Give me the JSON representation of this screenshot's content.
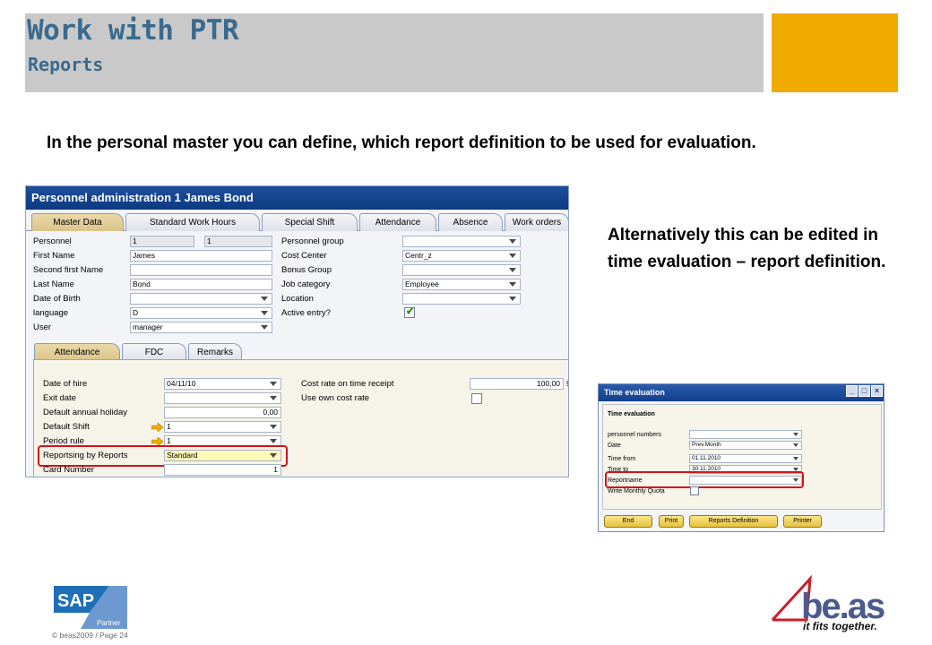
{
  "slide": {
    "title": "Work with PTR",
    "subtitle": "Reports",
    "intro_text": "In the personal master you can define, which report definition to be used for evaluation.",
    "alt_text": "Alternatively this can be edited in time evaluation – report definition.",
    "accent_color": "#f0ab00",
    "title_color": "#3a6a8e"
  },
  "personnel_window": {
    "title": "Personnel administration 1 James Bond",
    "tabs": [
      "Master Data",
      "Standard Work Hours",
      "Special Shift",
      "Attendance",
      "Absence",
      "Work orders"
    ],
    "active_tab": "Master Data",
    "left_fields": {
      "personnel_label": "Personnel",
      "personnel_value1": "1",
      "personnel_value2": "1",
      "first_name_label": "First Name",
      "first_name_value": "James",
      "second_first_name_label": "Second first Name",
      "second_first_name_value": "",
      "last_name_label": "Last Name",
      "last_name_value": "Bond",
      "date_of_birth_label": "Date of Birth",
      "date_of_birth_value": "",
      "language_label": "language",
      "language_value": "D",
      "user_label": "User",
      "user_value": "manager"
    },
    "right_fields": {
      "personnel_group_label": "Personnel group",
      "personnel_group_value": "",
      "cost_center_label": "Cost Center",
      "cost_center_value": "Centr_z",
      "bonus_group_label": "Bonus Group",
      "bonus_group_value": "",
      "job_category_label": "Job category",
      "job_category_value": "Employee",
      "location_label": "Location",
      "location_value": "",
      "active_entry_label": "Active entry?",
      "active_entry_checked": true
    },
    "subtabs": [
      "Attendance",
      "FDC",
      "Remarks"
    ],
    "active_subtab": "Attendance",
    "attendance": {
      "date_of_hire_label": "Date of hire",
      "date_of_hire_value": "04/11/10",
      "exit_date_label": "Exit date",
      "exit_date_value": "",
      "default_annual_holiday_label": "Default annual holiday",
      "default_annual_holiday_value": "0,00",
      "default_shift_label": "Default Shift",
      "default_shift_value": "1",
      "period_rule_label": "Period rule",
      "period_rule_value": "1",
      "reporting_label": "Reportsing by Reports",
      "reporting_value": "Standard",
      "card_number_label": "Card Number",
      "card_number_value": "1",
      "cost_rate_label": "Cost rate on time receipt",
      "cost_rate_value": "100,00",
      "cost_rate_suffix": "9",
      "own_cost_rate_label": "Use own cost rate",
      "own_cost_rate_checked": false
    }
  },
  "time_window": {
    "title": "Time evaluation",
    "heading": "Time evaluation",
    "personnel_numbers_label": "personnel numbers",
    "personnel_numbers_value": "",
    "date_label": "Date",
    "date_value": "Prev.Month",
    "time_from_label": "Time from",
    "time_from_value": "01.11.2010",
    "time_to_label": "Time to",
    "time_to_value": "30.11.2010",
    "reportname_label": "Reportname",
    "reportname_value": "",
    "monthly_quota_label": "Write Monthly Quota",
    "monthly_quota_checked": false,
    "buttons": [
      "End",
      "Print",
      "Reports Definition",
      "Printer"
    ]
  },
  "footer": {
    "copyright": "© beas2009 / Page 24",
    "sap_logo_text": "SAP",
    "sap_partner_text": "Partner",
    "beas_logo_text": "be.as",
    "beas_tagline": "it fits together."
  }
}
